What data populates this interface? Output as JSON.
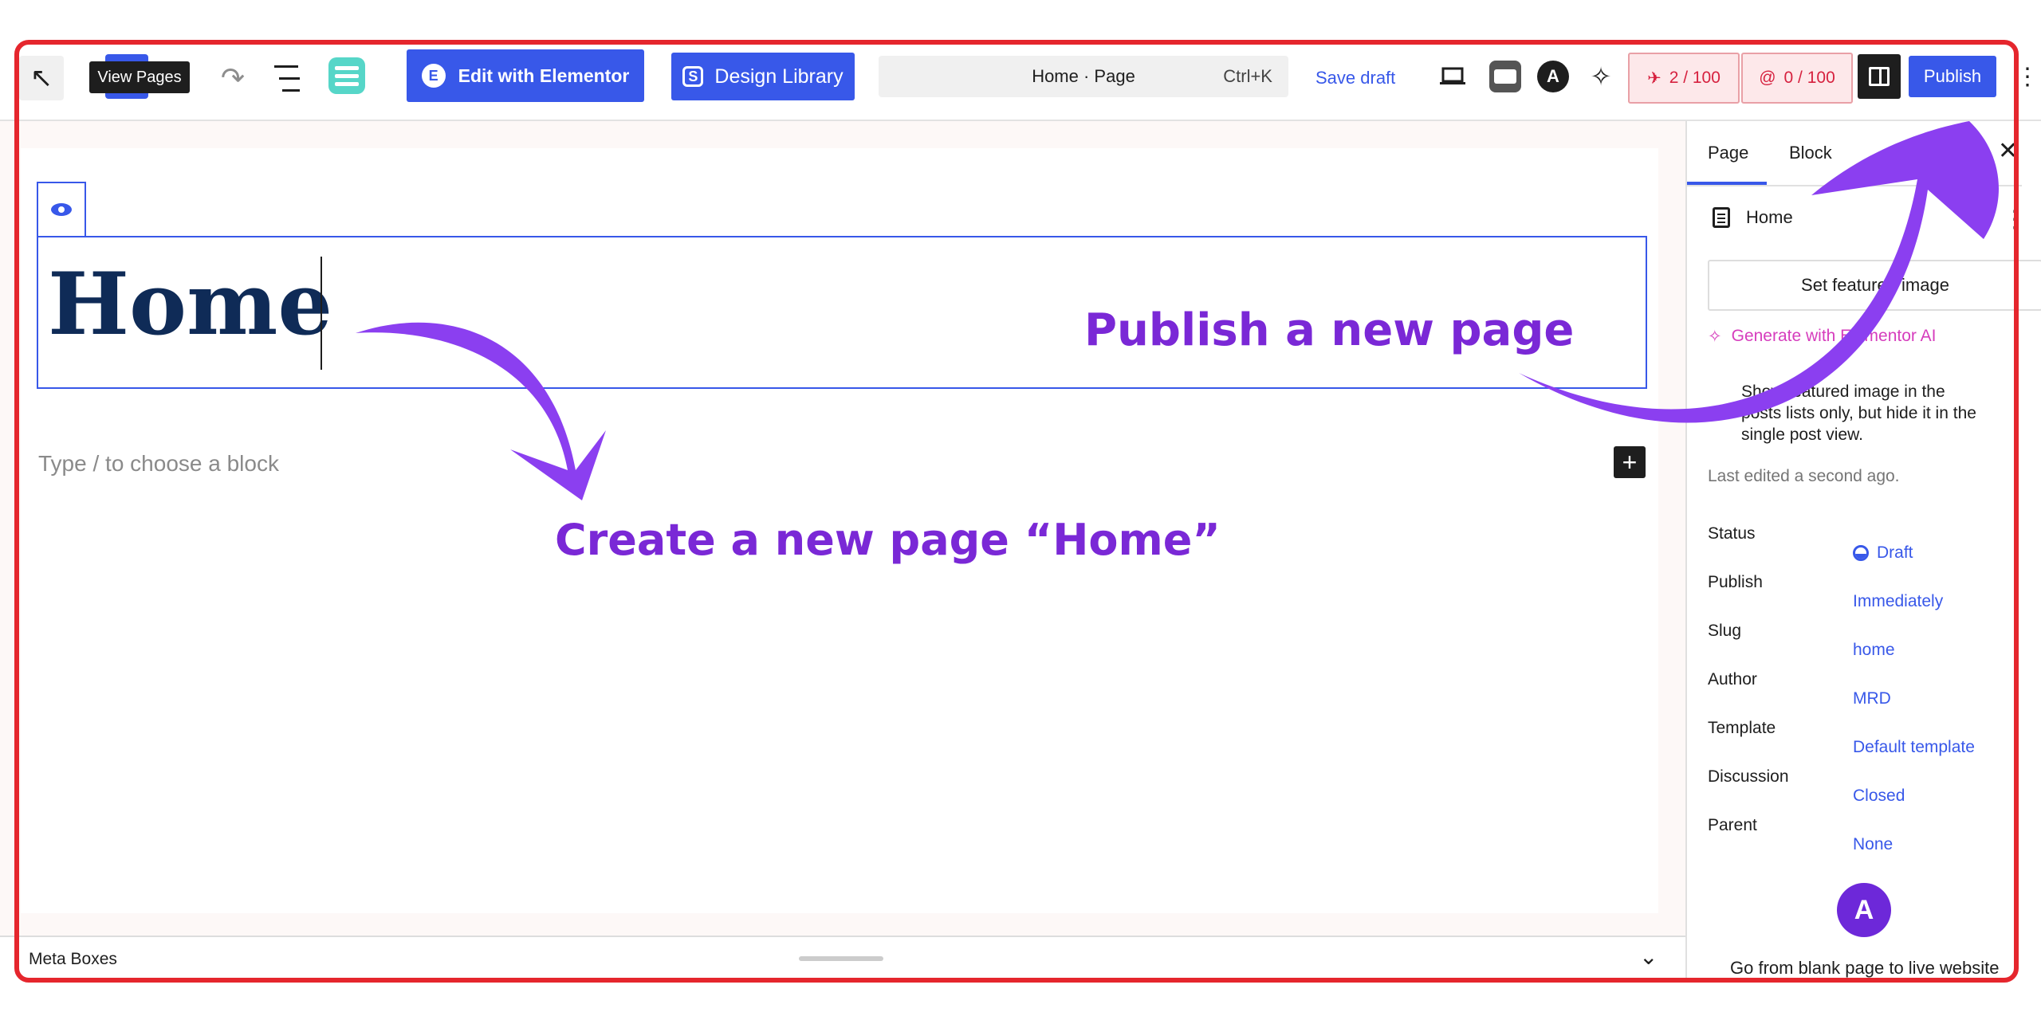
{
  "toolbar": {
    "back_icon": "arrow-up-left-icon",
    "tooltip": "View Pages",
    "undo_icon": "undo-icon",
    "redo_icon": "redo-icon",
    "list_view_icon": "list-view-icon",
    "edit_elementor": "Edit with Elementor",
    "design_library": "Design Library",
    "command_title": "Home · Page",
    "command_shortcut": "Ctrl+K",
    "save_draft": "Save draft",
    "counter_1": "2 / 100",
    "counter_2": "0 / 100",
    "publish": "Publish"
  },
  "editor": {
    "title": "Home",
    "placeholder": "Type / to choose a block"
  },
  "annotations": {
    "create": "Create a new page “Home”",
    "publish": "Publish a new page"
  },
  "sidebar": {
    "tabs": [
      "Page",
      "Block"
    ],
    "doc_title": "Home",
    "featured_image_button": "Set featured image",
    "generate_ai": "Generate with Elementor AI",
    "hide_featured_text": "Show featured image in the posts lists only, but hide it in the single post view.",
    "last_edited": "Last edited a second ago.",
    "meta": [
      {
        "label": "Status",
        "value": "Draft"
      },
      {
        "label": "Publish",
        "value": "Immediately"
      },
      {
        "label": "Slug",
        "value": "home"
      },
      {
        "label": "Author",
        "value": "MRD"
      },
      {
        "label": "Template",
        "value": "Default template"
      },
      {
        "label": "Discussion",
        "value": "Closed"
      },
      {
        "label": "Parent",
        "value": "None"
      }
    ],
    "promo": "Go from blank page to live website"
  },
  "meta_boxes": {
    "label": "Meta Boxes"
  },
  "colors": {
    "accent": "#3858e9",
    "annotation": "#7a28d6",
    "frame": "#e5262d",
    "counter": "#d6213f"
  }
}
